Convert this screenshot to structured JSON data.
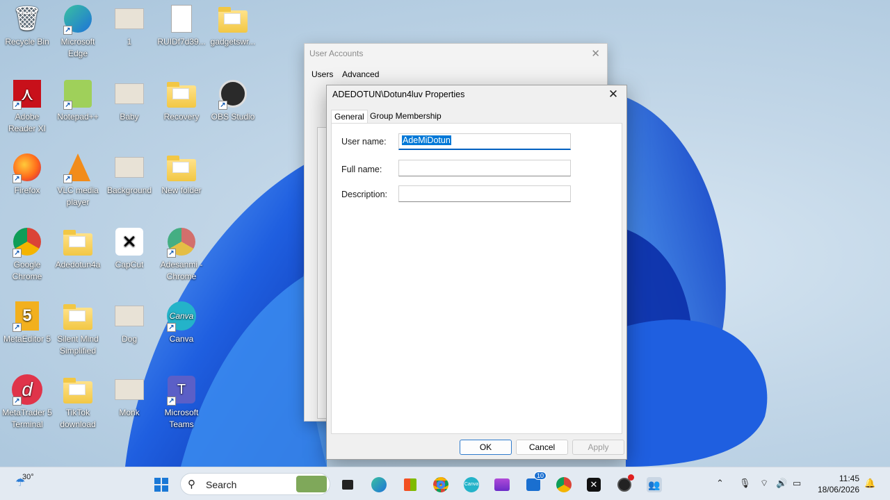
{
  "desktop": {
    "icons": [
      {
        "label": "Recycle Bin",
        "icon": "recycle-bin-icon"
      },
      {
        "label": "Microsoft Edge",
        "icon": "edge-icon"
      },
      {
        "label": "1",
        "icon": "image-file-icon"
      },
      {
        "label": "RUIDf7d39...",
        "icon": "blank-file-icon"
      },
      {
        "label": "gadgetswr...",
        "icon": "folder-icon"
      },
      {
        "label": "Adobe Reader XI",
        "icon": "adobe-reader-icon"
      },
      {
        "label": "Notepad++",
        "icon": "notepad-plus-plus-icon"
      },
      {
        "label": "Baby",
        "icon": "image-file-icon"
      },
      {
        "label": "Recovery",
        "icon": "folder-icon"
      },
      {
        "label": "OBS Studio",
        "icon": "obs-icon"
      },
      {
        "label": "Firefox",
        "icon": "firefox-icon"
      },
      {
        "label": "VLC media player",
        "icon": "vlc-icon"
      },
      {
        "label": "Background",
        "icon": "image-file-icon"
      },
      {
        "label": "New folder",
        "icon": "folder-icon"
      },
      {
        "label": "Google Chrome",
        "icon": "chrome-icon"
      },
      {
        "label": "Adedotun4a",
        "icon": "folder-icon"
      },
      {
        "label": "CapCut",
        "icon": "capcut-icon"
      },
      {
        "label": "Adesanmi - Chrome",
        "icon": "chrome-profile-icon"
      },
      {
        "label": "MetaEditor 5",
        "icon": "metaeditor-icon"
      },
      {
        "label": "Silent Mind Simplified",
        "icon": "folder-icon"
      },
      {
        "label": "Dog",
        "icon": "image-file-icon"
      },
      {
        "label": "Canva",
        "icon": "canva-icon"
      },
      {
        "label": "MetaTrader 5 Terminal",
        "icon": "metatrader-icon"
      },
      {
        "label": "TikTok download",
        "icon": "folder-icon"
      },
      {
        "label": "Monk",
        "icon": "image-file-icon"
      },
      {
        "label": "Microsoft Teams",
        "icon": "teams-icon"
      }
    ]
  },
  "back_window": {
    "title": "User Accounts",
    "tabs": [
      "Users",
      "Advanced"
    ]
  },
  "dialog": {
    "title": "ADEDOTUN\\Dotun4luv Properties",
    "tabs": [
      "General",
      "Group Membership"
    ],
    "active_tab": "General",
    "fields": {
      "user_name_label": "User name:",
      "user_name_value": "AdeMiDotun",
      "full_name_label": "Full name:",
      "full_name_value": "",
      "description_label": "Description:",
      "description_value": ""
    },
    "buttons": {
      "ok": "OK",
      "cancel": "Cancel",
      "apply": "Apply"
    }
  },
  "taskbar": {
    "weather_temp": "30°",
    "search_placeholder": "Search",
    "badge_count": "10",
    "time": "11:45",
    "date": "18/06/2026"
  },
  "colors": {
    "accent": "#0078d7",
    "wallpaper": "#1f5fe0"
  }
}
